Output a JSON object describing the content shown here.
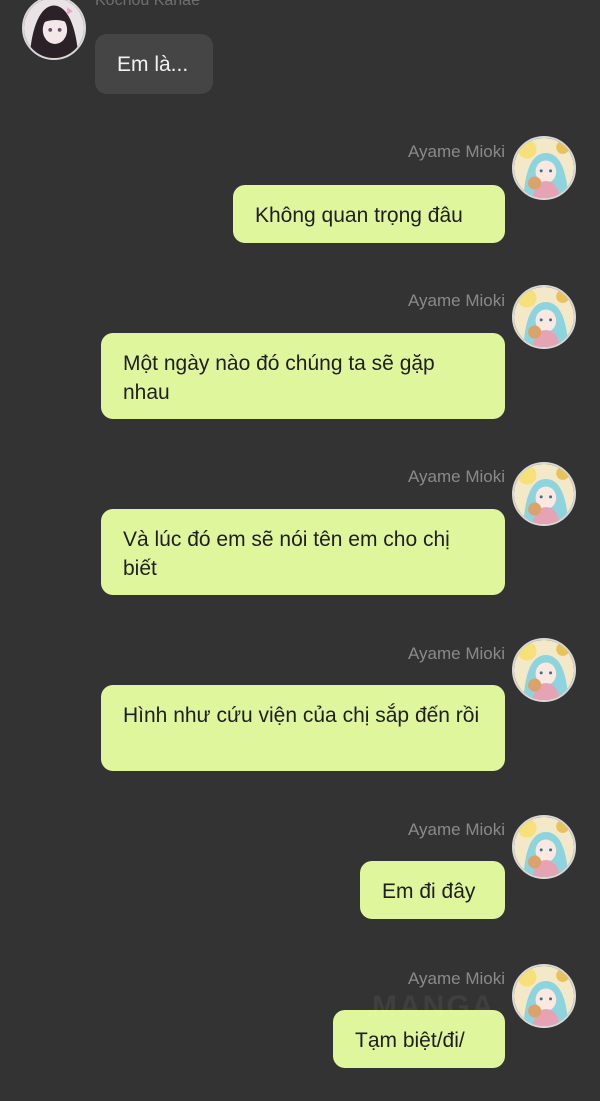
{
  "header_name": "Kochou Kanae",
  "incoming": {
    "text": "Em là..."
  },
  "outgoing_name": "Ayame Mioki",
  "messages": [
    {
      "sender": "Ayame Mioki",
      "text": "Không quan trọng đâu"
    },
    {
      "sender": "Ayame Mioki",
      "text": "Một ngày nào đó chúng ta sẽ gặp nhau"
    },
    {
      "sender": "Ayame Mioki",
      "text": "Và lúc đó em sẽ nói tên em cho chị biết"
    },
    {
      "sender": "Ayame Mioki",
      "text": "Hình như cứu viện của chị sắp đến rồi"
    },
    {
      "sender": "Ayame Mioki",
      "text": "Em đi đây"
    },
    {
      "sender": "Ayame Mioki",
      "text": "Tạm biệt/đi/"
    }
  ],
  "watermark": "MANGA"
}
